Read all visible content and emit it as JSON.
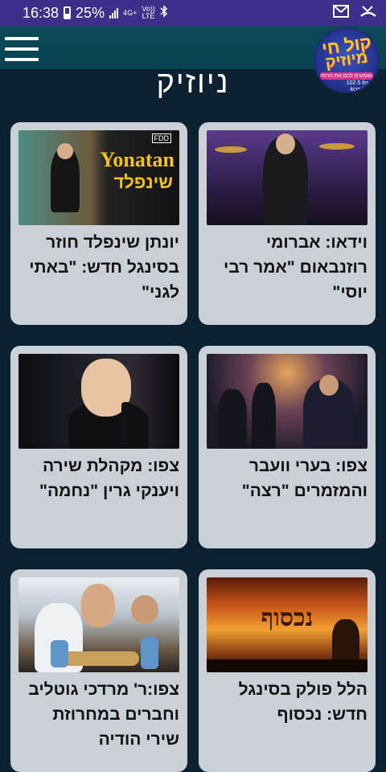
{
  "status_bar": {
    "time": "16:38",
    "battery": "25%",
    "network": "4G+",
    "volte_top": "Vo))",
    "volte_bottom": "LTE"
  },
  "header": {
    "menu_icon": "hamburger-icon",
    "logo_line1": "קול חי",
    "logo_line2": "מיוזיק",
    "logo_tagline": "שומעים לכם את הרוח",
    "logo_freq": "102.5 fm",
    "logo_site": "kcm.fm"
  },
  "page_title": "ניוזיק",
  "articles": [
    {
      "title": "וידאו: אברומי רוזנבאום \"אמר רבי יוסי\"",
      "thumb": "singer-on-stage"
    },
    {
      "title": "יונתן שינפלד חוזר בסינגל חדש: \"באתי לגני\"",
      "thumb": "album-cover",
      "thumb_text": {
        "fdd": "FDD",
        "name_en": "Yonatan",
        "name_he": "שינפלד"
      }
    },
    {
      "title": "צפו: בערי וועבר והמזמרים \"רצה\"",
      "thumb": "night-stage"
    },
    {
      "title": "צפו: מקהלת שירה ויענקי גרין \"נחמה\"",
      "thumb": "boy-singing"
    },
    {
      "title": "הלל פולק בסינגל חדש: נכסוף",
      "thumb": "sunset-cover",
      "thumb_text": {
        "word": "נכסוף"
      }
    },
    {
      "title": "צפו:ר' מרדכי גוטליב וחברים במחרוזת שירי הודיה",
      "thumb": "guitar-group"
    }
  ]
}
